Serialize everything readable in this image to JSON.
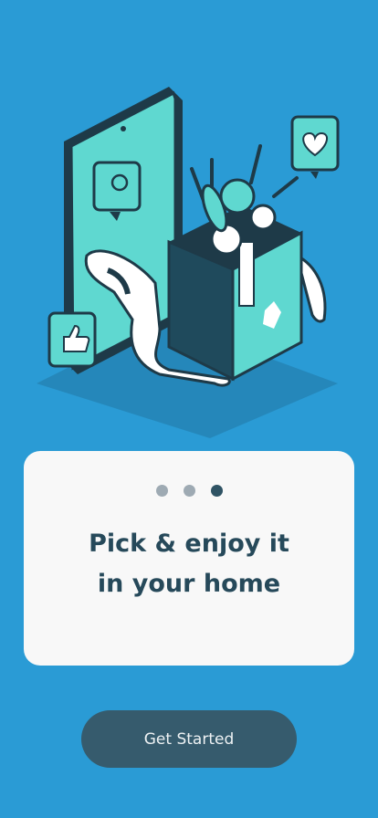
{
  "onboarding": {
    "title_line1": "Pick & enjoy it",
    "title_line2": "in your home",
    "page_dots": 3,
    "active_dot": 3,
    "cta_label": "Get Started"
  },
  "colors": {
    "background": "#2a9bd5",
    "card": "#f8f8f8",
    "title": "#26495a",
    "button": "#365b6d",
    "dot_inactive": "#9eaab3",
    "dot_active": "#2f5364"
  },
  "illustration": {
    "icons": [
      "phone-icon",
      "grocery-bag-icon",
      "hand-icon",
      "chat-location-bubble-icon",
      "heart-bubble-icon",
      "thumbs-up-bubble-icon"
    ]
  }
}
